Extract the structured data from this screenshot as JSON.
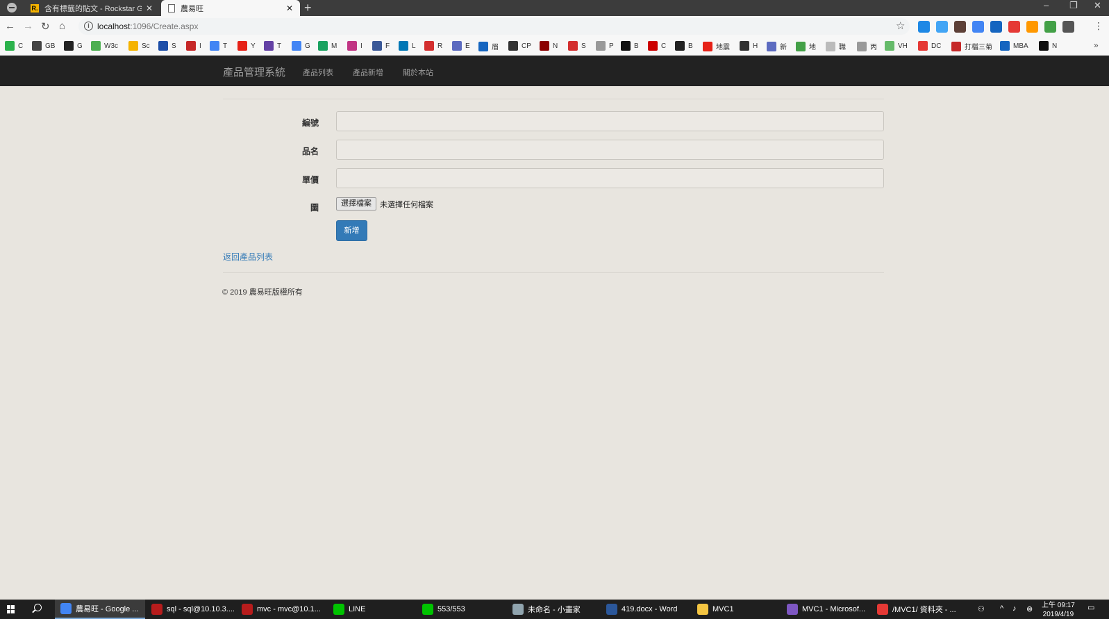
{
  "browser": {
    "tabs": [
      {
        "title": "含有標籤的貼文 - Rockstar Games",
        "favicon": "R."
      },
      {
        "title": "農易旺"
      }
    ],
    "url_host": "localhost",
    "url_rest": ":1096/Create.aspx",
    "bookmarks": [
      {
        "label": "C",
        "color": "#2bb24c"
      },
      {
        "label": "GB",
        "color": "#444"
      },
      {
        "label": "G",
        "color": "#222"
      },
      {
        "label": "W3c",
        "color": "#4caf50"
      },
      {
        "label": "Sc",
        "color": "#f5b300"
      },
      {
        "label": "S",
        "color": "#1e4fa8"
      },
      {
        "label": "I",
        "color": "#c62828"
      },
      {
        "label": "T",
        "color": "#4285f4"
      },
      {
        "label": "Y",
        "color": "#e62117"
      },
      {
        "label": "T",
        "color": "#6441a5"
      },
      {
        "label": "G",
        "color": "#4285f4"
      },
      {
        "label": "M",
        "color": "#1aa260"
      },
      {
        "label": "I",
        "color": "#c13584"
      },
      {
        "label": "F",
        "color": "#3b5998"
      },
      {
        "label": "L",
        "color": "#0077b5"
      },
      {
        "label": "R",
        "color": "#d32f2f"
      },
      {
        "label": "E",
        "color": "#5c6bc0"
      },
      {
        "label": "眉",
        "color": "#1565c0"
      },
      {
        "label": "CP",
        "color": "#333"
      },
      {
        "label": "N",
        "color": "#8b0000"
      },
      {
        "label": "S",
        "color": "#d32f2f"
      },
      {
        "label": "P",
        "color": "#999"
      },
      {
        "label": "B",
        "color": "#111"
      },
      {
        "label": "C",
        "color": "#cc0000"
      },
      {
        "label": "B",
        "color": "#222"
      },
      {
        "label": "地震",
        "color": "#e62117"
      },
      {
        "label": "H",
        "color": "#333"
      },
      {
        "label": "新",
        "color": "#5c6bc0"
      },
      {
        "label": "地",
        "color": "#43a047"
      },
      {
        "label": "職",
        "color": "#bbb"
      },
      {
        "label": "丙",
        "color": "#999"
      },
      {
        "label": "VH",
        "color": "#66bb6a"
      },
      {
        "label": "DC",
        "color": "#e53935"
      },
      {
        "label": "打檔三菊",
        "color": "#c62828"
      },
      {
        "label": "MBA",
        "color": "#1565c0"
      },
      {
        "label": "N",
        "color": "#111"
      }
    ],
    "extension_colors": [
      "#1e88e5",
      "#42a5f5",
      "#5d4037",
      "#4285f4",
      "#1565c0",
      "#e53935",
      "#ff9800",
      "#43a047",
      "#555"
    ]
  },
  "navbar": {
    "brand": "產品管理系統",
    "links": [
      "產品列表",
      "產品新增",
      "關於本站"
    ]
  },
  "form": {
    "fields": [
      {
        "label": "編號",
        "value": ""
      },
      {
        "label": "品名",
        "value": ""
      },
      {
        "label": "單價",
        "value": ""
      }
    ],
    "image_label": "圖",
    "file_button": "選擇檔案",
    "file_status": "未選擇任何檔案",
    "submit_label": "新增"
  },
  "back_link": "返回產品列表",
  "footer": "© 2019 農易旺版權所有",
  "taskbar": {
    "items": [
      {
        "label": "農易旺 - Google ...",
        "color": "#4285f4"
      },
      {
        "label": "sql - sql@10.10.3....",
        "color": "#b71c1c"
      },
      {
        "label": "mvc - mvc@10.1...",
        "color": "#b71c1c"
      },
      {
        "label": "LINE",
        "color": "#00c300"
      },
      {
        "label": "553/553",
        "color": "#00c300"
      },
      {
        "label": "未命名 - 小畫家",
        "color": "#90a4ae"
      },
      {
        "label": "419.docx - Word",
        "color": "#2b579a"
      },
      {
        "label": "MVC1",
        "color": "#f4c542"
      },
      {
        "label": "MVC1 - Microsof...",
        "color": "#7e57c2"
      },
      {
        "label": "/MVC1/ 資料夾 - ...",
        "color": "#e53935"
      }
    ],
    "time": "上午 09:17",
    "date": "2019/4/19"
  }
}
